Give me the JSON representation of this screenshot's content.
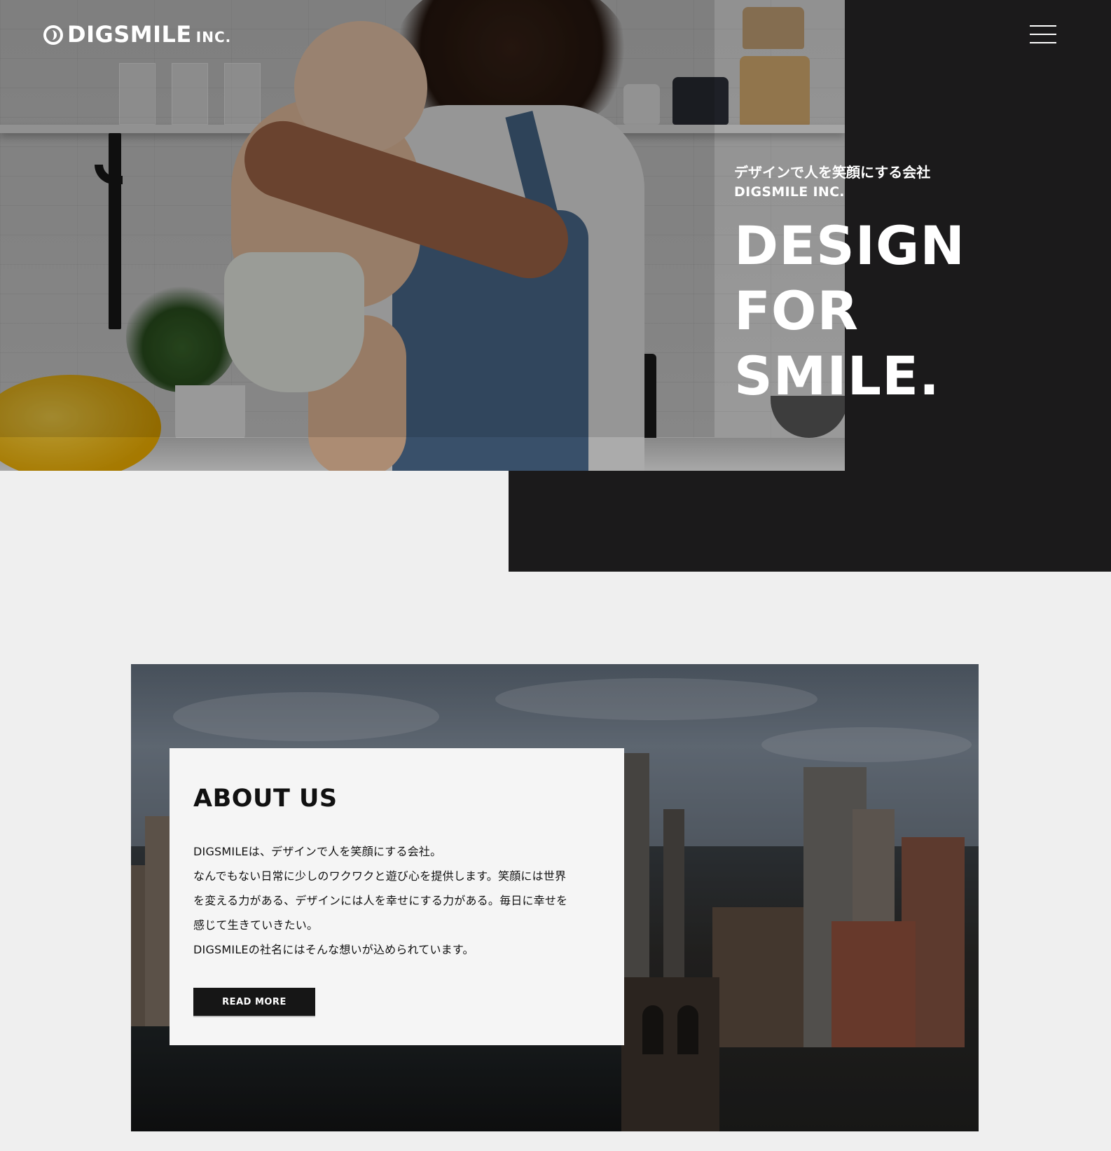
{
  "header": {
    "logo_text": "DIGSMILE",
    "logo_suffix": "INC.",
    "menu_icon": "hamburger-menu-icon"
  },
  "hero": {
    "tagline_jp": "デザインで人を笑顔にする会社",
    "tagline_en": "DIGSMILE INC.",
    "title_lines": [
      "DESIGN",
      "FOR",
      "SMILE."
    ],
    "image": "mother-holding-baby-in-kitchen-photo"
  },
  "about": {
    "title": "ABOUT US",
    "paragraph_lines": [
      "DIGSMILEは、デザインで人を笑顔にする会社。",
      "なんでもない日常に少しのワクワクと遊び心を提供します。笑顔には世界",
      "を変える力がある、デザインには人を幸せにする力がある。毎日に幸せを",
      "感じて生きていきたい。",
      "DIGSMILEの社名にはそんな想いが込められています。"
    ],
    "button_label": "READ MORE",
    "image": "city-skyline-with-bridge-photo"
  },
  "colors": {
    "dark_panel": "#1b1a1b",
    "page_background": "#efefef",
    "card_background": "#f5f5f5",
    "button_background": "#161616",
    "text_light": "#ffffff",
    "text_dark": "#111111"
  }
}
